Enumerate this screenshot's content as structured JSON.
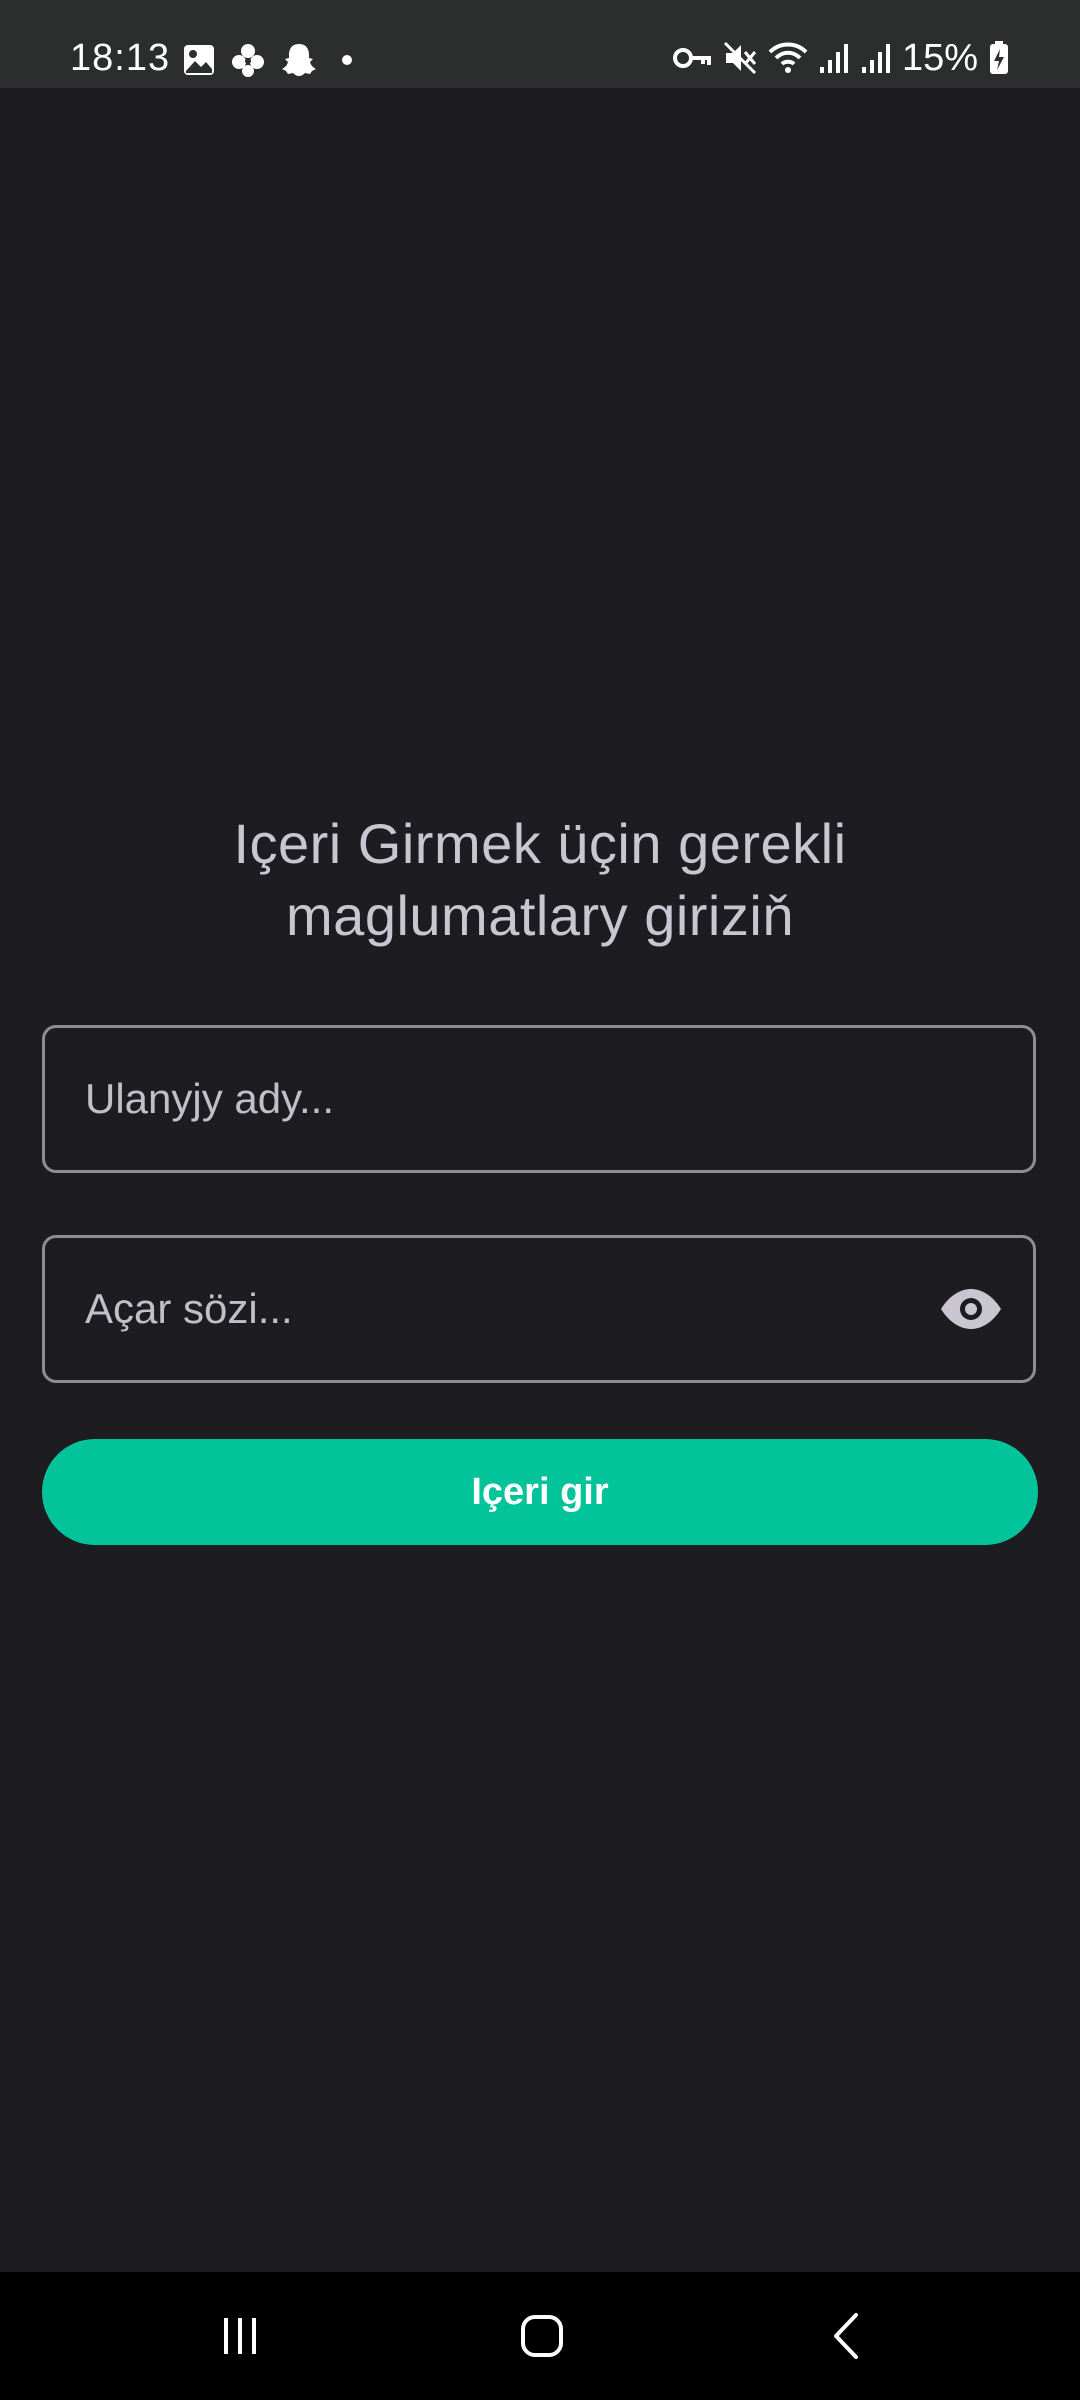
{
  "status_bar": {
    "time": "18:13",
    "battery_text": "15%",
    "left_icons": [
      "gallery-icon",
      "pinwheel-icon",
      "snapchat-icon",
      "dot-icon"
    ],
    "right_icons": [
      "key-icon",
      "mute-icon",
      "wifi-icon",
      "signal-icon",
      "signal-icon",
      "battery-charging-icon"
    ]
  },
  "login": {
    "title": "Içeri Girmek üçin gerekli maglumatlary giriziň",
    "username": {
      "value": "",
      "placeholder": "Ulanyjy ady..."
    },
    "password": {
      "value": "",
      "placeholder": "Açar sözi...",
      "toggle_icon": "eye-icon"
    },
    "submit_label": "Içeri gir"
  },
  "nav_bar": {
    "buttons": [
      "recents-icon",
      "home-icon",
      "back-icon"
    ]
  },
  "colors": {
    "background": "#1d1d21",
    "status_bar": "#2c2e2d",
    "accent": "#02c39a",
    "title_text": "#c9c5d1",
    "field_border": "#8e8d93"
  }
}
